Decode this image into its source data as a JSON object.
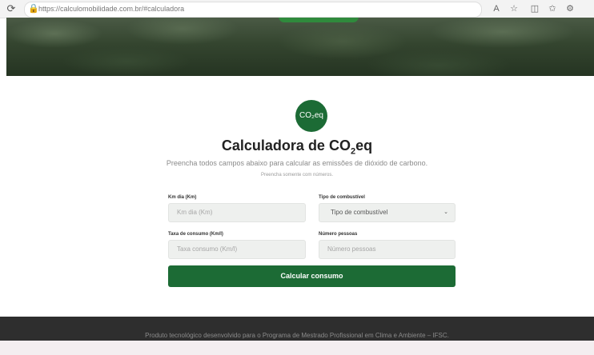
{
  "browser": {
    "url": "https://calculomobilidade.com.br/#calculadora",
    "icons": [
      "refresh-icon",
      "lock-icon",
      "read-aloud-icon",
      "favorite-icon",
      "split-screen-icon",
      "collections-icon",
      "extensions-icon"
    ]
  },
  "logo": {
    "text": "CO₂eq"
  },
  "main": {
    "title_prefix": "Calculadora de CO",
    "title_sub": "2",
    "title_suffix": "eq",
    "subtitle": "Preencha todos campos abaixo para calcular as emissões de dióxido de carbono.",
    "note": "Preencha somente com números."
  },
  "form": {
    "km_label": "Km dia (Km)",
    "km_placeholder": "Km dia (Km)",
    "fuel_label": "Tipo de combustível",
    "fuel_value": "Tipo de combustível",
    "consumption_label": "Taxa de consumo (Km/l)",
    "consumption_placeholder": "Taxa consumo (Km/l)",
    "people_label": "Número pessoas",
    "people_placeholder": "Número pessoas",
    "submit_label": "Calcular consumo"
  },
  "footer": {
    "text": "Produto tecnológico desenvolvido para o Programa de Mestrado Profissional em Clima e Ambiente – IFSC."
  },
  "colors": {
    "accent": "#1c6b35",
    "footer_bg": "#2e2e2e"
  }
}
